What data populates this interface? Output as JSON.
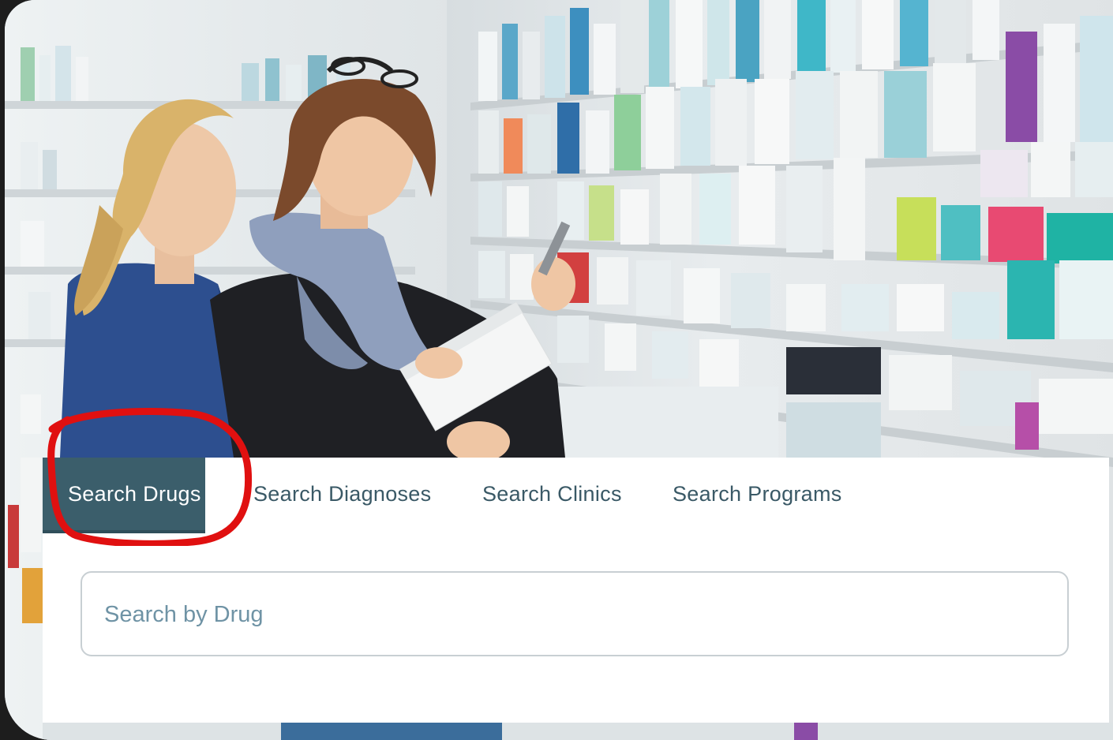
{
  "tabs": [
    {
      "label": "Search Drugs",
      "active": true
    },
    {
      "label": "Search Diagnoses",
      "active": false
    },
    {
      "label": "Search Clinics",
      "active": false
    },
    {
      "label": "Search Programs",
      "active": false
    }
  ],
  "search": {
    "placeholder": "Search by Drug",
    "value": ""
  },
  "hero": {
    "image_subject": "pharmacy-scene"
  },
  "colors": {
    "active_tab": "#3b5e6b",
    "tab_text": "#3a5966",
    "placeholder": "#6f93a5",
    "annotation": "#e01010"
  }
}
